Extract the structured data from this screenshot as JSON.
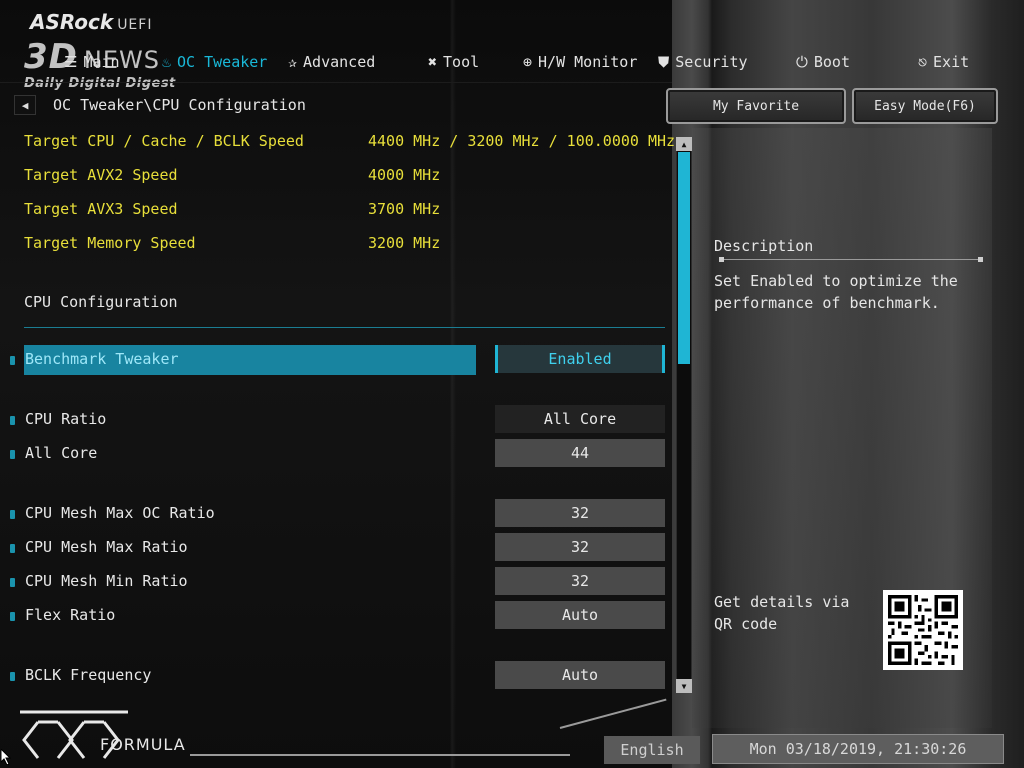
{
  "logo": {
    "brand": "ASRock",
    "suffix": "UEFI"
  },
  "watermark": {
    "big": "3D",
    "news": "NEWS",
    "small": "Daily Digital Digest"
  },
  "nav": {
    "items": [
      {
        "label": "Main",
        "icon": "list-icon"
      },
      {
        "label": "OC Tweaker",
        "icon": "flame-icon",
        "active": true
      },
      {
        "label": "Advanced",
        "icon": "star-icon"
      },
      {
        "label": "Tool",
        "icon": "tools-icon"
      },
      {
        "label": "H/W Monitor",
        "icon": "crosshair-icon"
      },
      {
        "label": "Security",
        "icon": "shield-icon"
      },
      {
        "label": "Boot",
        "icon": "power-icon"
      },
      {
        "label": "Exit",
        "icon": "exit-icon"
      }
    ]
  },
  "breadcrumb": "OC Tweaker\\CPU Configuration",
  "top_buttons": {
    "favorite": "My Favorite",
    "easy_mode": "Easy Mode(F6)"
  },
  "targets": [
    {
      "label": "Target CPU / Cache / BCLK Speed",
      "value": "4400 MHz / 3200 MHz / 100.0000 MHz"
    },
    {
      "label": "Target AVX2 Speed",
      "value": "4000 MHz"
    },
    {
      "label": "Target AVX3 Speed",
      "value": "3700 MHz"
    },
    {
      "label": "Target Memory Speed",
      "value": "3200 MHz"
    }
  ],
  "section_title": "CPU Configuration",
  "settings": [
    {
      "label": "Benchmark Tweaker",
      "value": "Enabled"
    },
    {
      "label": "CPU Ratio",
      "value": "All Core"
    },
    {
      "label": "All Core",
      "value": "44"
    },
    {
      "label": "CPU Mesh Max OC Ratio",
      "value": "32"
    },
    {
      "label": "CPU Mesh Max Ratio",
      "value": "32"
    },
    {
      "label": "CPU Mesh Min Ratio",
      "value": "32"
    },
    {
      "label": "Flex Ratio",
      "value": "Auto"
    },
    {
      "label": "BCLK Frequency",
      "value": "Auto"
    }
  ],
  "description": {
    "title": "Description",
    "text": "Set Enabled to optimize the performance of benchmark."
  },
  "qr": {
    "text": "Get details via QR code"
  },
  "footer": {
    "formula": "FORMULA",
    "language": "English",
    "datetime": "Mon 03/18/2019, 21:30:26"
  },
  "colors": {
    "accent": "#1fb5d4",
    "target_text": "#e8df3a",
    "selected_row": "#1884a0"
  }
}
